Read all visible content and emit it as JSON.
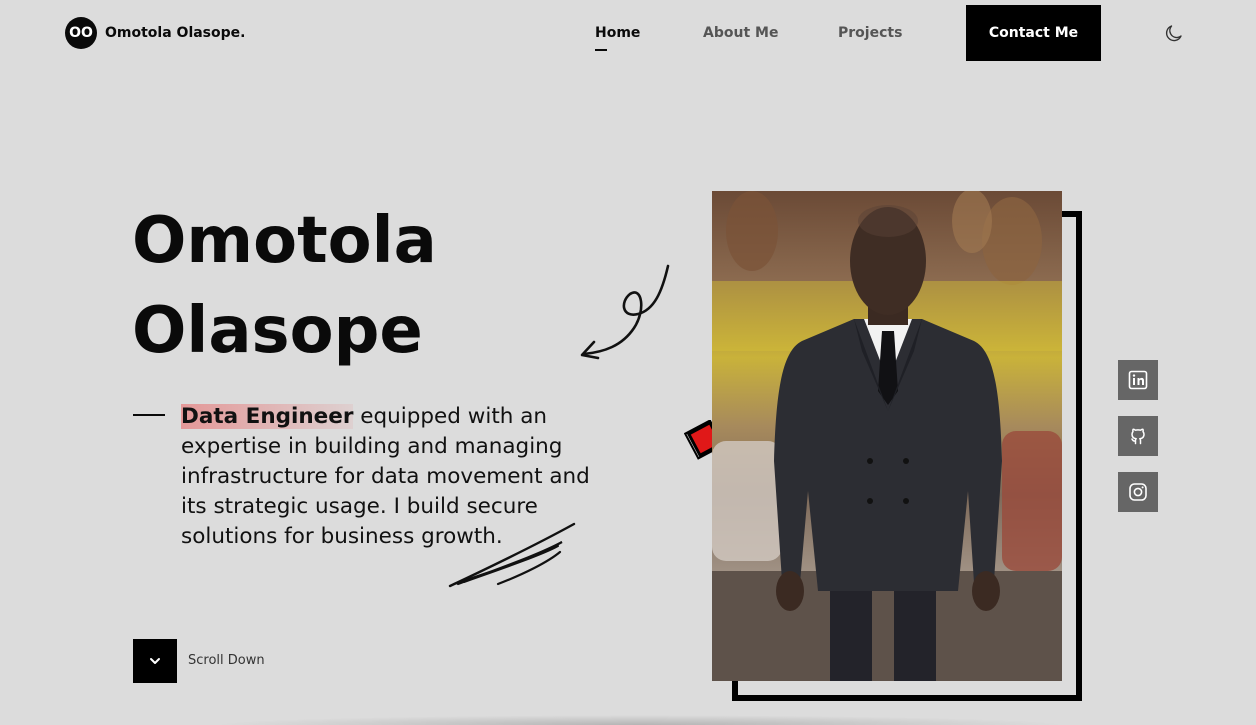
{
  "nav": {
    "logo_initials": "OO",
    "logo_name": "Omotola Olasope.",
    "links": [
      {
        "label": "Home",
        "active": true
      },
      {
        "label": "About Me",
        "active": false
      },
      {
        "label": "Projects",
        "active": false
      }
    ],
    "contact_label": "Contact Me",
    "theme_icon": "moon-icon"
  },
  "hero": {
    "name_line1": "Omotola",
    "name_line2": "Olasope",
    "role": "Data Engineer",
    "description": " equipped with an expertise in building and managing infrastructure for data movement and its strategic usage. I build secure solutions for business growth.",
    "highlight_color": "#e58c8c"
  },
  "scroll": {
    "label": "Scroll Down",
    "icon": "chevron-down-icon"
  },
  "photo": {
    "alt": "Portrait photo",
    "frame_color": "#000000"
  },
  "social": [
    {
      "name": "linkedin",
      "icon": "linkedin-icon"
    },
    {
      "name": "github",
      "icon": "github-icon"
    },
    {
      "name": "instagram",
      "icon": "instagram-icon"
    }
  ],
  "colors": {
    "background": "#dcdcdc",
    "accent": "#000000",
    "diamond": "#e01818",
    "social_bg": "#666666"
  }
}
